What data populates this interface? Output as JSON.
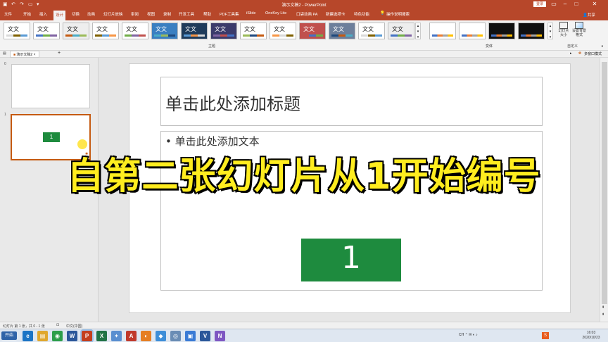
{
  "window": {
    "title": "演示文稿2 - PowerPoint",
    "login_label": "登录",
    "share_label": "共享"
  },
  "menu": {
    "tabs": [
      "文件",
      "开始",
      "插入",
      "设计",
      "切换",
      "动画",
      "幻灯片放映",
      "审阅",
      "视图",
      "录制",
      "开发工具",
      "帮助",
      "PDF工具集",
      "iSlide",
      "OneKey Lite",
      "口袋动画 PA",
      "新建选项卡",
      "特色功能"
    ],
    "tell_me": "操作说明搜索"
  },
  "ribbon": {
    "themes_group": "主题",
    "variants_group": "变体",
    "customize_group": "自定义",
    "theme_text": "文文",
    "slide_size": "幻灯片大小",
    "format_bg": "设置背景格式",
    "colors": {
      "theme_strips": [
        "#d9d9d9",
        "#4472c4",
        "#c55a11",
        "#7f6000",
        "#70ad47",
        "#4bacc6",
        "#5b9bd5",
        "#8064a2",
        "#9bbb59",
        "#f79646",
        "#c0504d",
        "#1f497d"
      ],
      "variants": [
        "#ffffff",
        "#ffffff",
        "#111111",
        "#111111"
      ]
    }
  },
  "doc_tab": {
    "label": "演示文稿2",
    "multi_window": "多窗口模式"
  },
  "thumbnails": [
    {
      "number": "0",
      "box_text": ""
    },
    {
      "number": "1",
      "box_text": "1"
    }
  ],
  "slide": {
    "title_placeholder": "单击此处添加标题",
    "body_placeholder": "• 单击此处添加文本",
    "green_box_text": "1",
    "accent_color": "#1e8b3e"
  },
  "caption": "自第二张幻灯片从1开始编号",
  "statusbar": {
    "slide_info": "幻灯片 第 1 张，共 0 - 1 张",
    "language": "中文(中国)"
  },
  "taskbar": {
    "start_label": "开始",
    "time": "16:03",
    "date": "2020/10/23",
    "icons": [
      "ie-icon",
      "folder-icon",
      "chrome-icon",
      "word-icon",
      "powerpoint-icon",
      "excel-icon",
      "tool-icon",
      "pdf-icon",
      "photo-icon",
      "app-icon",
      "search-icon",
      "picture-icon",
      "visio-icon",
      "notes-icon"
    ]
  }
}
